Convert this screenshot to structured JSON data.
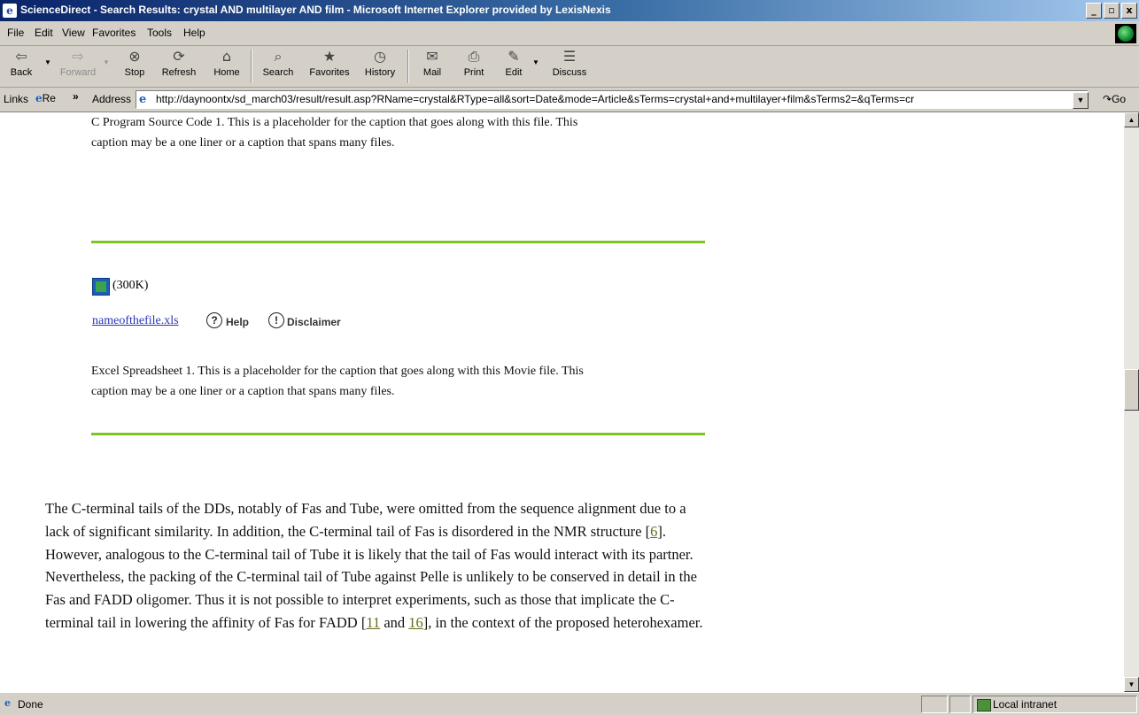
{
  "window": {
    "title": "ScienceDirect - Search Results: crystal AND multilayer AND film - Microsoft Internet Explorer provided by LexisNexis",
    "app_icon": "ie-icon",
    "controls": [
      "_",
      "8",
      "x"
    ]
  },
  "menu": [
    "File",
    "Edit",
    "View",
    "Favorites",
    "Tools",
    "Help"
  ],
  "toolbar": {
    "back": "Back",
    "forward": "Forward",
    "stop": "Stop",
    "refresh": "Refresh",
    "home": "Home",
    "search": "Search",
    "favorites": "Favorites",
    "history": "History",
    "mail": "Mail",
    "print": "Print",
    "edit": "Edit",
    "discuss": "Discuss"
  },
  "addressbar": {
    "links_label": "Links",
    "links_item": "Re",
    "chevron": "»",
    "address_label": "Address",
    "url": "http://daynoontx/sd_march03/result/result.asp?RName=crystal&RType=all&sort=Date&mode=Article&sTerms=crystal+and+multilayer+film&sTerms2=&qTerms=cr",
    "go_label": "Go"
  },
  "content": {
    "caption1_line1": "C Program Source Code 1. This is a placeholder for the caption that goes along with this file.  This",
    "caption1_line2": "caption may be a one liner or a caption that spans many files.",
    "file_size": "(300K)",
    "file_link": "nameofthefile.xls",
    "help_label": "Help",
    "disclaimer_label": "Disclaimer",
    "caption2_line1": "Excel Spreadsheet 1. This is a placeholder for the caption that goes along with this Movie file.  This",
    "caption2_line2": "caption may be a one liner or a caption that spans many files.",
    "para_1": "The C-terminal tails of the DDs, notably of Fas and Tube, were omitted from the sequence alignment due to a lack of significant similarity. In addition, the C-terminal tail of Fas is disordered in the NMR structure [",
    "ref_6": "6",
    "para_2": "]. However, analogous to the C-terminal tail of Tube it is likely that the tail of Fas would interact with its partner. Nevertheless, the packing of the C-terminal tail of Tube against Pelle is unlikely to be conserved in detail in the Fas and FADD oligomer. Thus it is not possible to interpret experiments, such as those that implicate the C-terminal tail in lowering the affinity of Fas for FADD [",
    "ref_11": "11",
    "para_and": " and ",
    "ref_16": "16",
    "para_3": "], in the context of the proposed heterohexamer."
  },
  "status": {
    "text": "Done",
    "zone": "Local intranet"
  },
  "colors": {
    "rule_green": "#7cc41e",
    "link_blue": "#2a35b8",
    "ref_link": "#6b6b1e"
  }
}
